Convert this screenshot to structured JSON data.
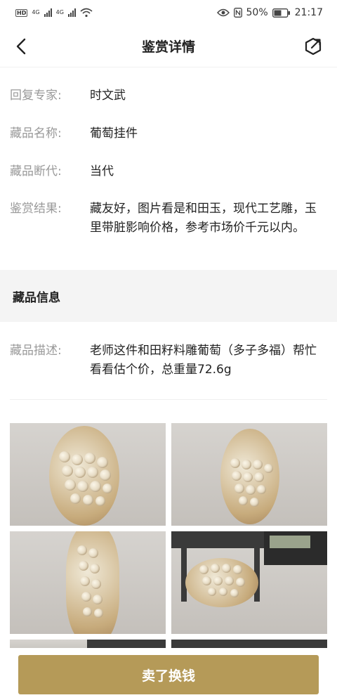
{
  "status_bar": {
    "network1": "4G",
    "network2": "4G",
    "battery": "50%",
    "time": "21:17"
  },
  "nav": {
    "title": "鉴赏详情"
  },
  "details": {
    "expert_label": "回复专家:",
    "expert_value": "时文武",
    "name_label": "藏品名称:",
    "name_value": "葡萄挂件",
    "era_label": "藏品断代:",
    "era_value": "当代",
    "result_label": "鉴赏结果:",
    "result_value": "藏友好，图片看是和田玉，现代工艺雕，玉里带脏影响价格，参考市场价千元以内。"
  },
  "collection": {
    "section_title": "藏品信息",
    "desc_label": "藏品描述:",
    "desc_value": "老师这件和田籽料雕葡萄（多子多福）帮忙看看估个价，总重量72.6g"
  },
  "action": {
    "sell_label": "卖了换钱"
  }
}
